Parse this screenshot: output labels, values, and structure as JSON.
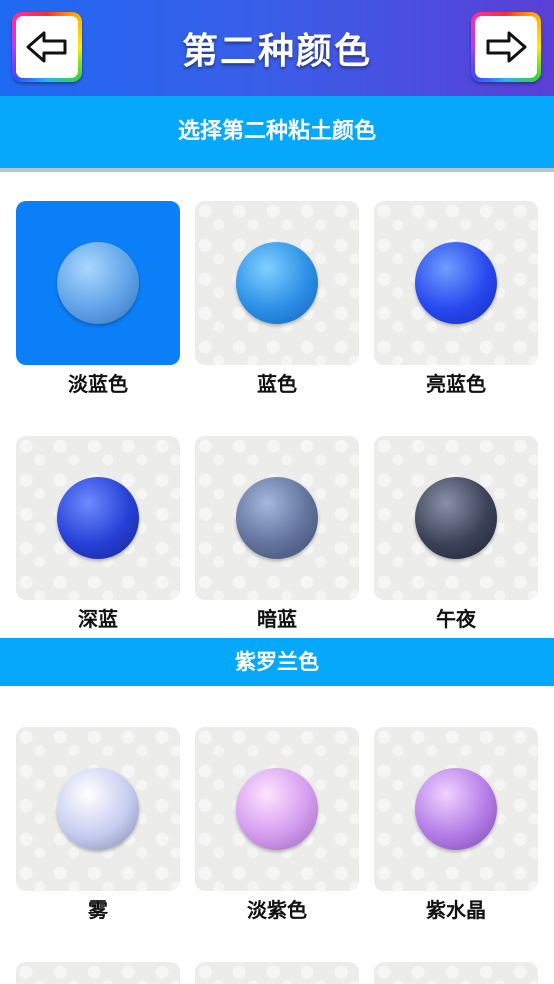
{
  "header": {
    "title": "第二种颜色"
  },
  "subtitle": "选择第二种粘土颜色",
  "section_violet": "紫罗兰色",
  "colors": [
    {
      "label": "淡蓝色",
      "light": "#a9d7ff",
      "base": "#5fa3e8",
      "dark": "#3a6fb5"
    },
    {
      "label": "蓝色",
      "light": "#7fd0ff",
      "base": "#2b8fe6",
      "dark": "#1761b8"
    },
    {
      "label": "亮蓝色",
      "light": "#6f9dff",
      "base": "#2848ee",
      "dark": "#142db8"
    },
    {
      "label": "深蓝",
      "light": "#6d8bff",
      "base": "#2640d6",
      "dark": "#17248f"
    },
    {
      "label": "暗蓝",
      "light": "#a6b7dc",
      "base": "#61729c",
      "dark": "#3c4a6e"
    },
    {
      "label": "午夜",
      "light": "#8a90a8",
      "base": "#3b4258",
      "dark": "#1d2133"
    },
    {
      "label": "雾",
      "light": "#ffffff",
      "base": "#c7cdf0",
      "dark": "#7f86aa"
    },
    {
      "label": "淡紫色",
      "light": "#ffe3ff",
      "base": "#d39cef",
      "dark": "#9a64bd"
    },
    {
      "label": "紫水晶",
      "light": "#f0d2ff",
      "base": "#b47ce6",
      "dark": "#7b48b0"
    }
  ],
  "next_row": [
    "",
    "",
    ""
  ]
}
